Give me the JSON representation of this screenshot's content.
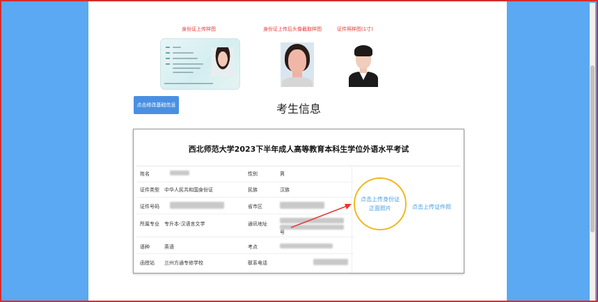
{
  "samples": {
    "idcard_label": "身份证上传样图",
    "headshot_label": "身份证上传后头像截取样图",
    "idphoto_label": "证件照样图(1寸)"
  },
  "actions": {
    "edit_basic_info": "点击修改基础信息"
  },
  "section_title": "考生信息",
  "exam_title": "西北师范大学2023下半年成人高等教育本科生学位外语水平考试",
  "fields": {
    "name_label": "姓名",
    "gender_label": "性别",
    "gender_value": "男",
    "id_type_label": "证件类型",
    "id_type_value": "中华人民共和国身份证",
    "ethnicity_label": "民族",
    "ethnicity_value": "汉族",
    "id_number_label": "证件号码",
    "region_label": "省市区",
    "major_label": "所属专业",
    "major_value": "专升本-汉语言文学",
    "address_label": "通讯地址",
    "address_tail": "号",
    "language_label": "语种",
    "language_value": "英语",
    "exam_site_label": "考点",
    "station_label": "函授站",
    "station_value": "兰州方通专修学校",
    "phone_label": "联系电话"
  },
  "upload": {
    "id_front_line1": "点击上传身份证",
    "id_front_line2": "正面照片",
    "id_photo": "点击上传证件照"
  },
  "colors": {
    "page_background": "#5aa9f2",
    "outer_border": "#d32f2f",
    "sample_label": "#e53935",
    "button": "#4a90e2",
    "link": "#4a9fe0",
    "highlight_circle": "#f0b81f",
    "annotation_arrow": "#e53935"
  }
}
